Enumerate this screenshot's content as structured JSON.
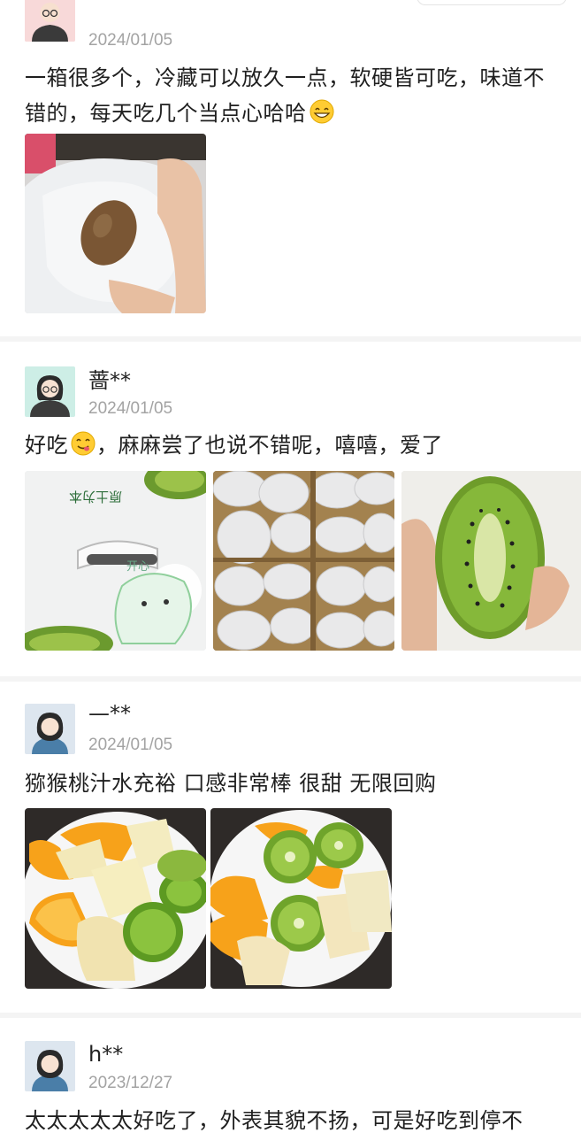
{
  "reviews": [
    {
      "username": "",
      "date": "2024/01/05",
      "text": "一箱很多个，冷藏可以放久一点，软硬皆可吃，味道不错的，每天吃几个当点心哈哈",
      "emoji": "grinning-face-emoji",
      "photos": [
        {
          "name": "kiwi-in-bag-photo"
        }
      ]
    },
    {
      "username": "蔷**",
      "date": "2024/01/05",
      "text_before_emoji": "好吃",
      "emoji": "yum-face-emoji",
      "text_after_emoji": "，麻麻尝了也说不错呢，嘻嘻，爱了",
      "photos": [
        {
          "name": "kiwi-box-photo",
          "box_text": "原土为本",
          "sticker_text": "开心"
        },
        {
          "name": "kiwi-packed-foam-photo"
        },
        {
          "name": "kiwi-cut-half-photo"
        }
      ]
    },
    {
      "username": "—**",
      "date": "2024/01/05",
      "text": "猕猴桃汁水充裕 口感非常棒 很甜 无限回购",
      "photos": [
        {
          "name": "fruit-plate-photo-1"
        },
        {
          "name": "fruit-plate-photo-2"
        }
      ]
    },
    {
      "username": "h**",
      "date": "2023/12/27",
      "text": "太太太太太好吃了，外表其貌不扬，可是好吃到停不"
    }
  ],
  "colors": {
    "background": "#f4f4f4",
    "card": "#ffffff",
    "date_gray": "#a3a3a3",
    "text": "#1f1f1f"
  }
}
